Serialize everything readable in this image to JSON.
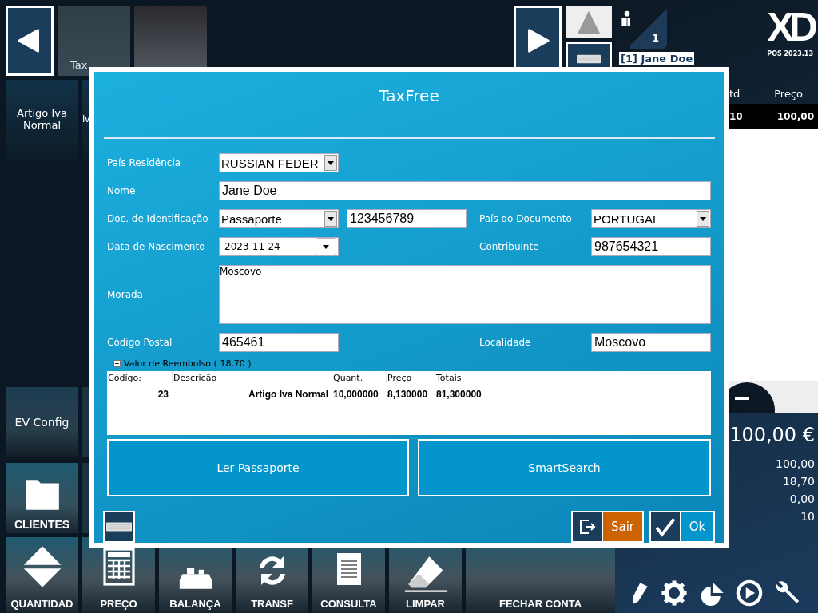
{
  "top_tiles": [
    {
      "kind": "labeled",
      "label": "Tax"
    },
    {
      "kind": "blank"
    }
  ],
  "second_row_tiles": [
    {
      "label": "Artigo Iva Normal"
    },
    {
      "label": "Iv"
    }
  ],
  "side_tiles": [
    {
      "kind": "text",
      "label": "EV Config"
    },
    {
      "kind": "folder",
      "label": "CLIENTES"
    }
  ],
  "bottom_buttons": [
    {
      "kind": "quantity",
      "label": "QUANTIDAD"
    },
    {
      "kind": "price",
      "label": "PREÇO"
    },
    {
      "kind": "scale",
      "label": "BALANÇA"
    },
    {
      "kind": "transfer",
      "label": "TRANSF"
    },
    {
      "kind": "document",
      "label": "CONSULTA"
    },
    {
      "kind": "eraser",
      "label": "LIMPAR"
    },
    {
      "kind": "close",
      "label": "FECHAR CONTA"
    }
  ],
  "client": {
    "number": "1",
    "name": "[1] Jane Doe"
  },
  "brand": {
    "logo": "XD",
    "version": "POS 2023.13"
  },
  "order": {
    "columns": [
      "td",
      "Preço"
    ],
    "rows": [
      {
        "qty": "10",
        "price": "100,00",
        "selected": true
      }
    ]
  },
  "total": "100,00 €",
  "summary": [
    "100,00",
    "18,70",
    "0,00",
    "10"
  ],
  "dialog": {
    "title": "TaxFree",
    "rows": [
      {
        "left": {
          "label": "País Residência",
          "controls": [
            {
              "kind": "dropdown",
              "value": "RUSSIAN FEDER"
            }
          ]
        }
      },
      {
        "left": {
          "label": "Nome",
          "controls": [
            {
              "kind": "text",
              "value": "Jane Doe"
            }
          ]
        }
      },
      {
        "left": {
          "label": "Doc. de Identificação",
          "controls": [
            {
              "kind": "dropdown",
              "value": "Passaporte"
            },
            {
              "kind": "text",
              "value": "123456789"
            }
          ]
        },
        "right": {
          "label": "País do Documento",
          "controls": [
            {
              "kind": "dropdown",
              "value": "PORTUGAL"
            }
          ]
        }
      },
      {
        "left": {
          "label": "Data de Nascimento",
          "controls": [
            {
              "kind": "date",
              "value": "2023-11-24"
            }
          ]
        },
        "right": {
          "label": "Contribuinte",
          "controls": [
            {
              "kind": "text",
              "value": "987654321"
            }
          ]
        }
      },
      {
        "left": {
          "label": "Morada",
          "controls": [
            {
              "kind": "multiline",
              "value": "Moscovo"
            }
          ]
        }
      },
      {
        "left": {
          "label": "Código Postal",
          "controls": [
            {
              "kind": "text",
              "value": "465461"
            }
          ]
        },
        "right": {
          "label": "Localidade",
          "controls": [
            {
              "kind": "text",
              "value": "Moscovo"
            }
          ]
        }
      }
    ],
    "refund": {
      "label": "Valor de Reembolso ( 18,70 )",
      "expanded": true
    },
    "table": {
      "columns": [
        "Código:",
        "Descrição",
        "Quant.",
        "Preço",
        "Totais"
      ],
      "rows": [
        [
          "23",
          "Artigo Iva Normal",
          "10,000000",
          "8,130000",
          "81,300000"
        ]
      ]
    },
    "actions": [
      "Ler Passaporte",
      "SmartSearch"
    ],
    "buttons": [
      {
        "kind": "exit",
        "label": "Sair"
      },
      {
        "kind": "confirm",
        "label": "Ok"
      }
    ]
  }
}
